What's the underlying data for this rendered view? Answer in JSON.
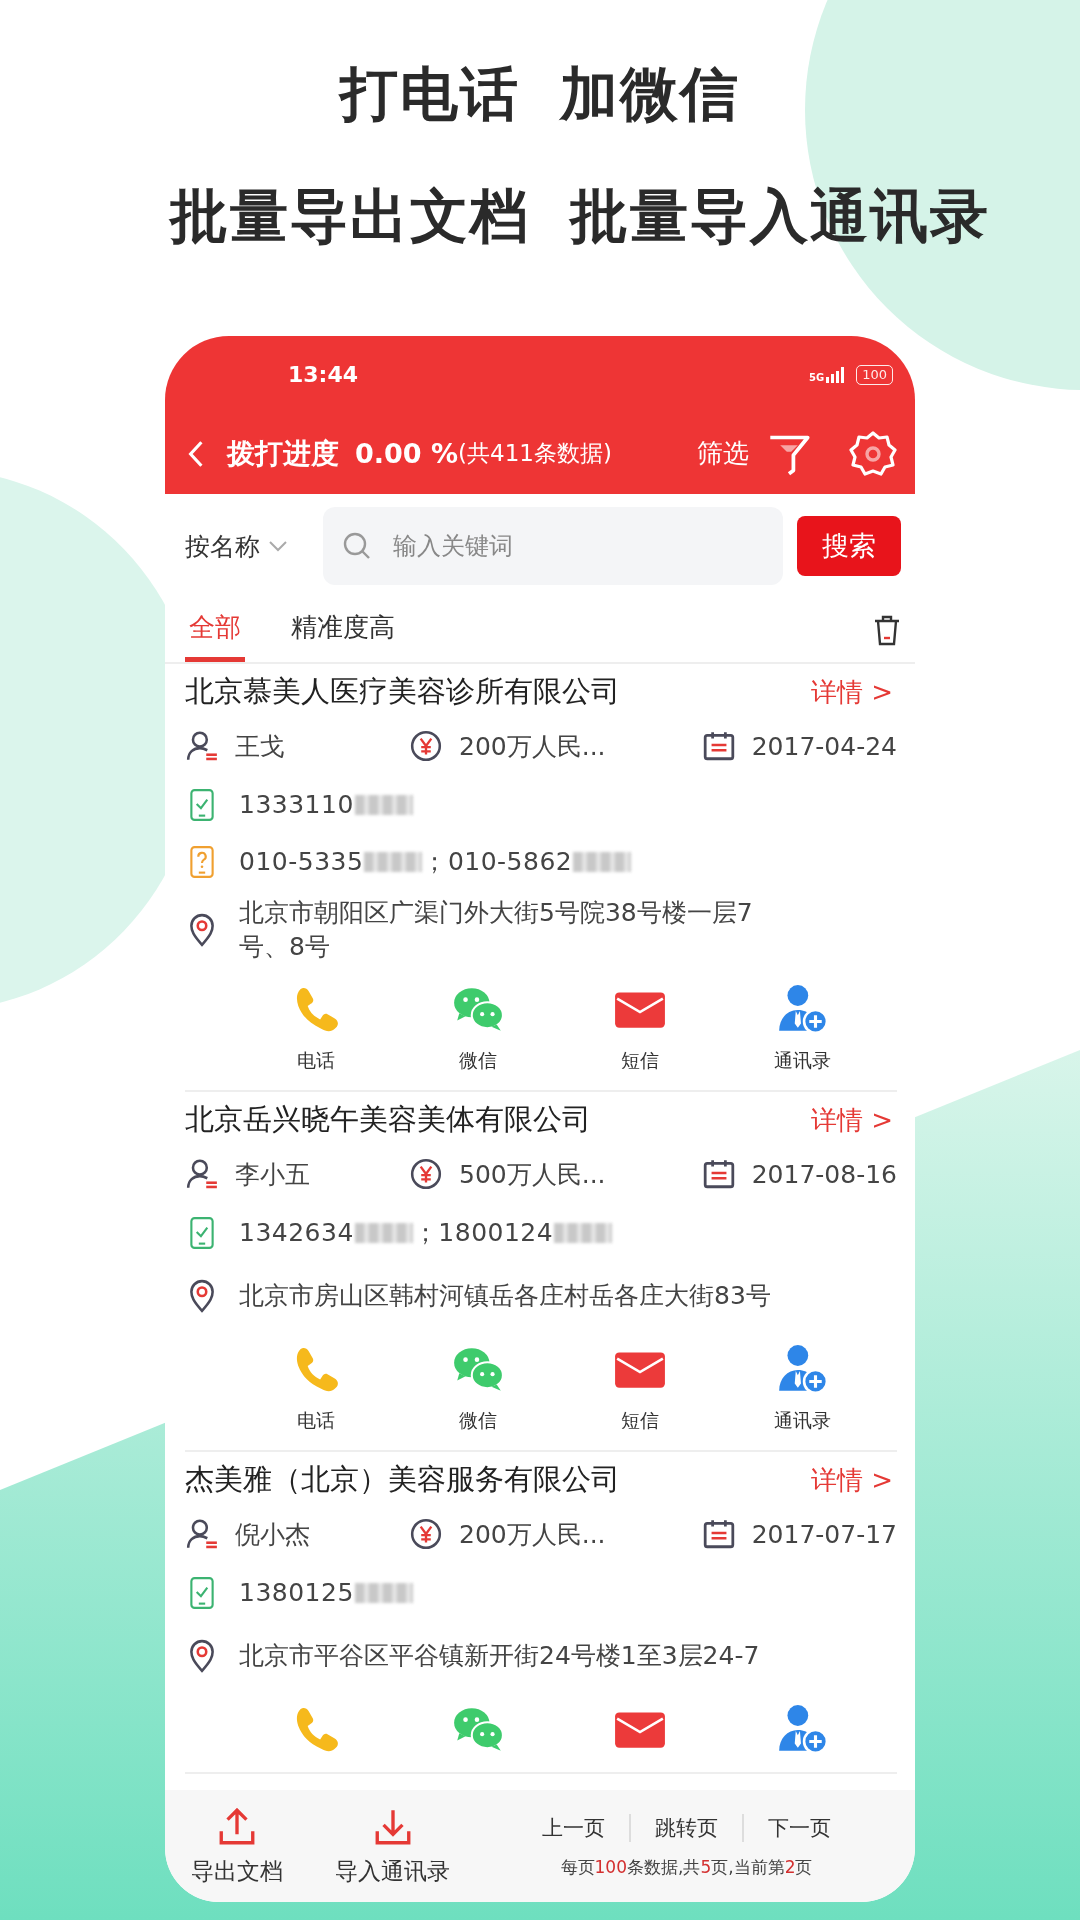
{
  "headline": [
    [
      "打电话",
      "加微信"
    ],
    [
      "批量导出文档",
      "批量导入通讯录"
    ]
  ],
  "status_bar": {
    "time": "13:44",
    "network": "5G",
    "battery": "100"
  },
  "header": {
    "title": "拨打进度",
    "progress": "0.00 %",
    "count": "(共411条数据)",
    "filter": "筛选"
  },
  "search": {
    "scope": "按名称",
    "placeholder": "输入关键词",
    "button": "搜索"
  },
  "tabs": [
    {
      "label": "全部",
      "selected": true
    },
    {
      "label": "精准度高",
      "selected": false
    }
  ],
  "companies": [
    {
      "name": "北京慕美人医疗美容诊所有限公司",
      "detail": "详情 >",
      "contact": "王戈",
      "capital": "200万人民...",
      "date": "2017-04-24",
      "mobiles": [
        "1333110"
      ],
      "phones": [
        "010-5335",
        "；010-5862"
      ],
      "address": "北京市朝阳区广渠门外大街5号院38号楼一层7号、8号",
      "actions": [
        {
          "kind": "call",
          "label": "电话"
        },
        {
          "kind": "wechat",
          "label": "微信"
        },
        {
          "kind": "sms",
          "label": "短信"
        },
        {
          "kind": "contacts",
          "label": "通讯录"
        }
      ]
    },
    {
      "name": "北京岳兴晓午美容美体有限公司",
      "detail": "详情 >",
      "contact": "李小五",
      "capital": "500万人民...",
      "date": "2017-08-16",
      "mobiles": [
        "1342634",
        "；1800124"
      ],
      "address": "北京市房山区韩村河镇岳各庄村岳各庄大街83号",
      "actions": [
        {
          "kind": "call",
          "label": "电话"
        },
        {
          "kind": "wechat",
          "label": "微信"
        },
        {
          "kind": "sms",
          "label": "短信"
        },
        {
          "kind": "contacts",
          "label": "通讯录"
        }
      ]
    },
    {
      "name": "杰美雅（北京）美容服务有限公司",
      "detail": "详情 >",
      "contact": "倪小杰",
      "capital": "200万人民...",
      "date": "2017-07-17",
      "mobiles": [
        "1380125"
      ],
      "address": "北京市平谷区平谷镇新开街24号楼1至3层24-7",
      "actions": [
        {
          "kind": "call"
        },
        {
          "kind": "wechat"
        },
        {
          "kind": "sms"
        },
        {
          "kind": "contacts"
        }
      ]
    }
  ],
  "bottom_actions": [
    {
      "kind": "export",
      "label": "导出文档"
    },
    {
      "kind": "import",
      "label": "导入通讯录"
    }
  ],
  "pagination": {
    "links": [
      "上一页",
      "跳转页",
      "下一页"
    ],
    "summary": [
      {
        "text": "每页",
        "highlight": false
      },
      {
        "text": "100",
        "highlight": true
      },
      {
        "text": "条数据,共",
        "highlight": false
      },
      {
        "text": "5",
        "highlight": true
      },
      {
        "text": "页,当前第",
        "highlight": false
      },
      {
        "text": "2",
        "highlight": true
      },
      {
        "text": "页",
        "highlight": false
      }
    ]
  }
}
